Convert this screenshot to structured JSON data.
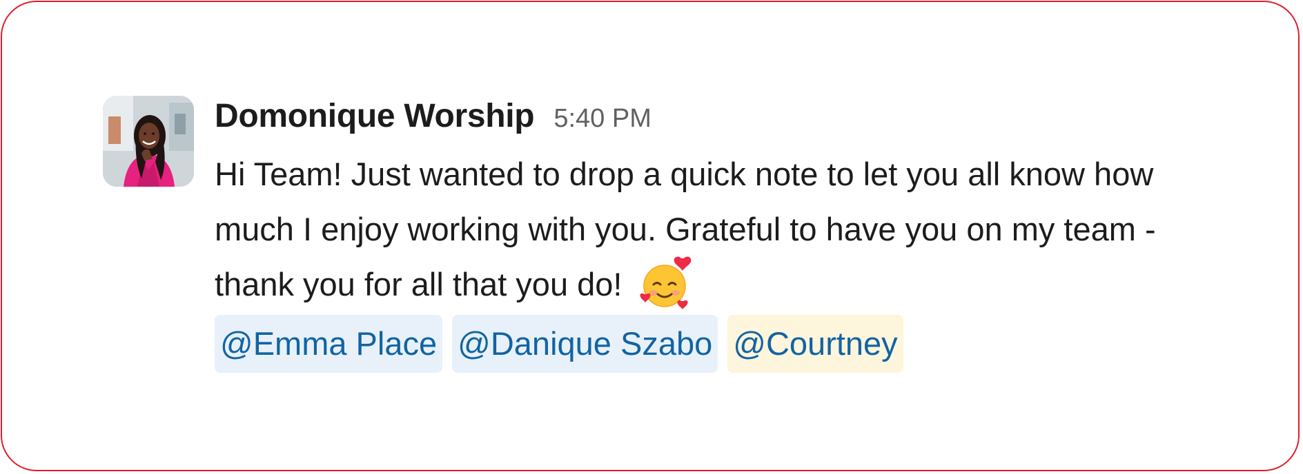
{
  "message": {
    "author": "Domonique Worship",
    "time": "5:40 PM",
    "text": "Hi Team! Just wanted to drop a quick note to let you all know how much I enjoy working with you. Grateful to have you on my team - thank you for all that you do!",
    "emoji": "smiling-face-with-hearts-icon",
    "mentions": [
      "@Emma Place",
      "@Danique Szabo",
      "@Courtney"
    ]
  },
  "colors": {
    "frame_border": "#e01e2a",
    "mention_text": "#1264a3",
    "mention_bg": "#e8f1fa",
    "self_mention_bg": "#fdf5dc"
  }
}
